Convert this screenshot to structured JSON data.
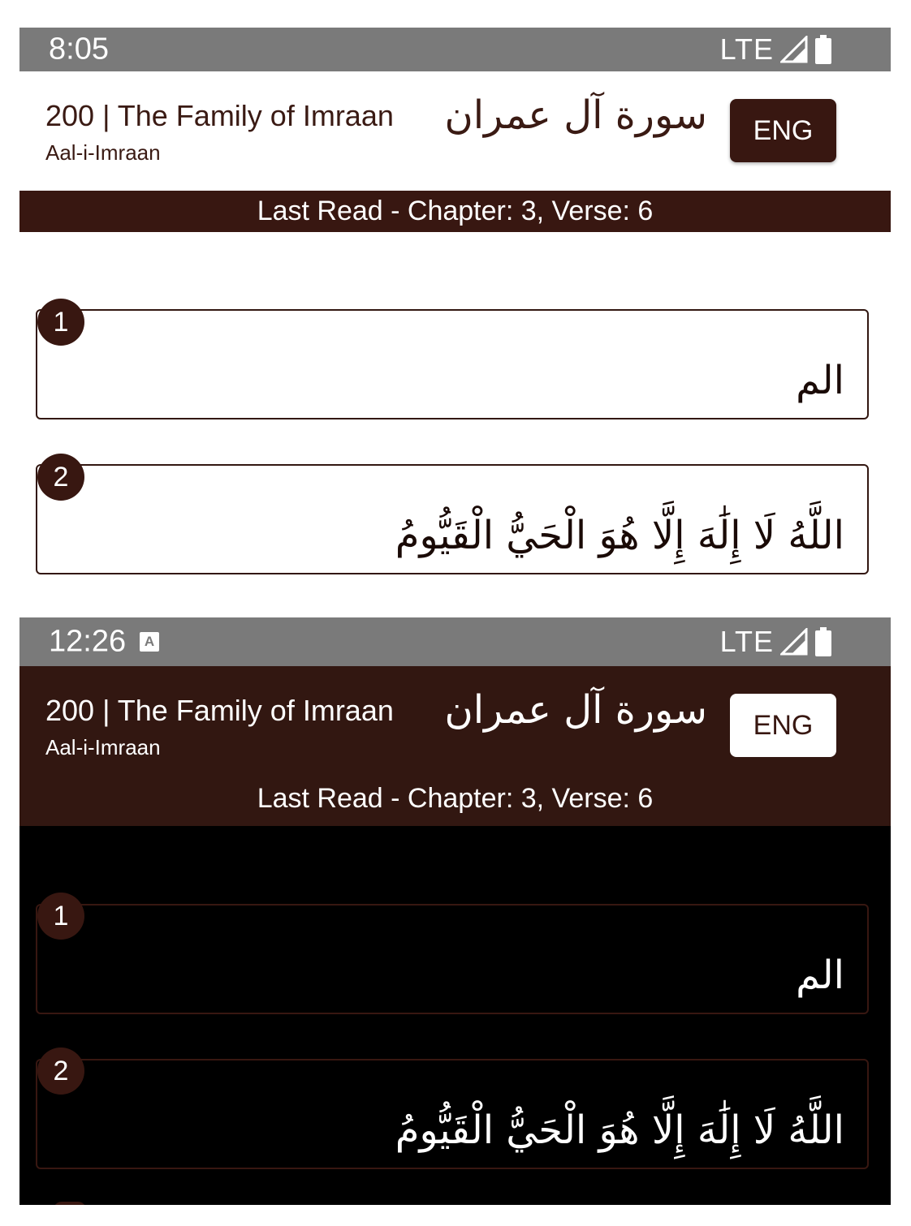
{
  "light": {
    "status": {
      "time": "8:05",
      "network": "LTE"
    },
    "header": {
      "title_en": "200 | The Family of Imraan",
      "subtitle": "Aal-i-Imraan",
      "title_ar": "سورة آل عمران",
      "lang_button": "ENG"
    },
    "last_read": "Last Read - Chapter: 3, Verse: 6",
    "verses": [
      {
        "number": "1",
        "text": "الم"
      },
      {
        "number": "2",
        "text": "اللَّهُ لَا إِلَٰهَ إِلَّا هُوَ الْحَيُّ الْقَيُّومُ"
      }
    ]
  },
  "dark": {
    "status": {
      "time": "12:26",
      "network": "LTE"
    },
    "header": {
      "title_en": "200 | The Family of Imraan",
      "subtitle": "Aal-i-Imraan",
      "title_ar": "سورة آل عمران",
      "lang_button": "ENG"
    },
    "last_read": "Last Read - Chapter: 3, Verse: 6",
    "verses": [
      {
        "number": "1",
        "text": "الم"
      },
      {
        "number": "2",
        "text": "اللَّهُ لَا إِلَٰهَ إِلَّا هُوَ الْحَيُّ الْقَيُّومُ"
      }
    ]
  },
  "colors": {
    "brand_dark_brown": "#381711",
    "status_bar_gray": "#7a7a7a",
    "dark_background": "#000000"
  },
  "icons": [
    "signal-icon",
    "battery-icon",
    "notification-a-icon"
  ]
}
